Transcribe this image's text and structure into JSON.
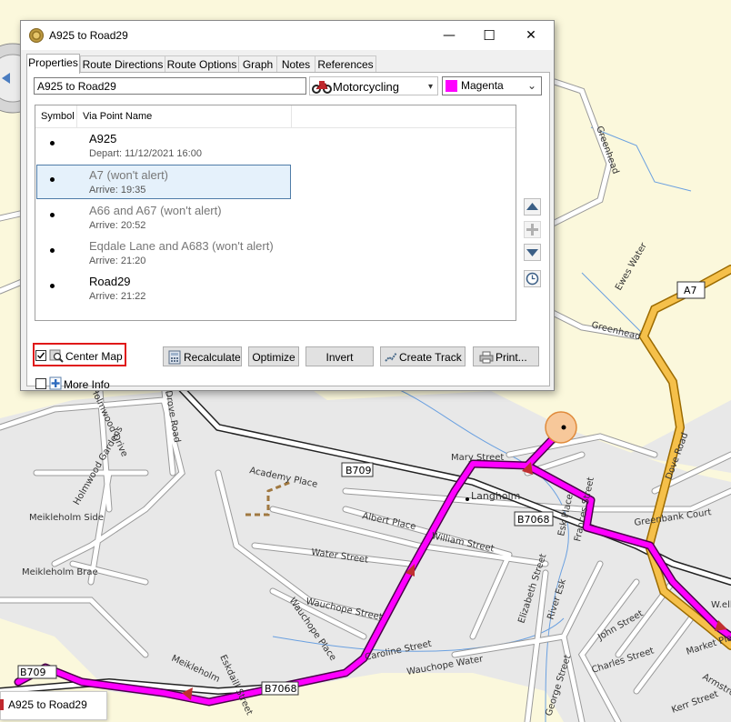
{
  "window": {
    "title": "A925 to Road29",
    "minimize": "—",
    "maximize": "☐",
    "close": "✕"
  },
  "tabs": [
    "Properties",
    "Route Directions",
    "Route Options",
    "Graph",
    "Notes",
    "References"
  ],
  "route_name": "A925 to Road29",
  "vehicle": {
    "label": "Motorcycling",
    "icon": "motorcycle-icon"
  },
  "color": {
    "label": "Magenta",
    "swatch": "#ff00ff"
  },
  "list": {
    "columns": [
      "Symbol",
      "Via Point Name"
    ],
    "rows": [
      {
        "name": "A925",
        "sub": "Depart: 11/12/2021 16:00"
      },
      {
        "name": "A7 (won't alert)",
        "sub": "Arrive: 19:35"
      },
      {
        "name": "A66 and  A67 (won't alert)",
        "sub": "Arrive: 20:52"
      },
      {
        "name": "Eqdale Lane and  A683 (won't alert)",
        "sub": "Arrive: 21:20"
      },
      {
        "name": "Road29",
        "sub": "Arrive: 21:22"
      }
    ]
  },
  "checkboxes": {
    "center_map": "Center Map",
    "more_info": "More Info",
    "center_map_checked": true,
    "more_info_checked": false
  },
  "buttons": {
    "recalculate": "Recalculate",
    "optimize": "Optimize",
    "invert": "Invert",
    "create_track": "Create Track",
    "print": "Print..."
  },
  "map": {
    "labels": [
      "Mary Street",
      "Langholm",
      "B709",
      "B7068",
      "Academy Place",
      "Albert Place",
      "William Street",
      "Water Street",
      "Wauchope Street",
      "Wauchope Place",
      "Wauchope Water",
      "Elizabeth Street",
      "River Esk",
      "John Street",
      "Charles Street",
      "George Street",
      "Market Place",
      "Greenbank Court",
      "Dove Road",
      "Ewes Water",
      "Greenhead",
      "Meikleholm Side",
      "Meikleholm Brae",
      "Holmwood Gardens",
      "Holmwood Drive",
      "Greenhead",
      "Meikleholm",
      "Eskdaill Street",
      "Drove Road",
      "Armstrong",
      "Kerr Street",
      "Esk Place",
      "Frances Street",
      "Caroline Street",
      "B7068",
      "B709",
      "A7",
      "W.ell"
    ],
    "route_color": "#ff00ff",
    "tooltip": "A925 to Road29"
  }
}
